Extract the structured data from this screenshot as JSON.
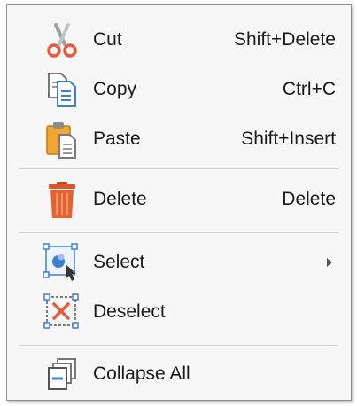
{
  "menu": {
    "items": [
      {
        "label": "Cut",
        "shortcut": "Shift+Delete",
        "icon": "scissors-icon"
      },
      {
        "label": "Copy",
        "shortcut": "Ctrl+C",
        "icon": "copy-icon"
      },
      {
        "label": "Paste",
        "shortcut": "Shift+Insert",
        "icon": "paste-icon"
      },
      {
        "label": "Delete",
        "shortcut": "Delete",
        "icon": "trash-icon"
      },
      {
        "label": "Select",
        "shortcut": "",
        "icon": "select-icon",
        "has_submenu": true
      },
      {
        "label": "Deselect",
        "shortcut": "",
        "icon": "deselect-icon"
      },
      {
        "label": "Collapse All",
        "shortcut": "",
        "icon": "collapse-all-icon"
      }
    ]
  },
  "colors": {
    "menu_background": "#f7f7f7",
    "border": "#8e8e8e",
    "separator": "#d4d4d4",
    "accent_blue": "#3c7fd1",
    "delete_orange": "#e8622e",
    "scissors_red": "#e55a3c"
  }
}
